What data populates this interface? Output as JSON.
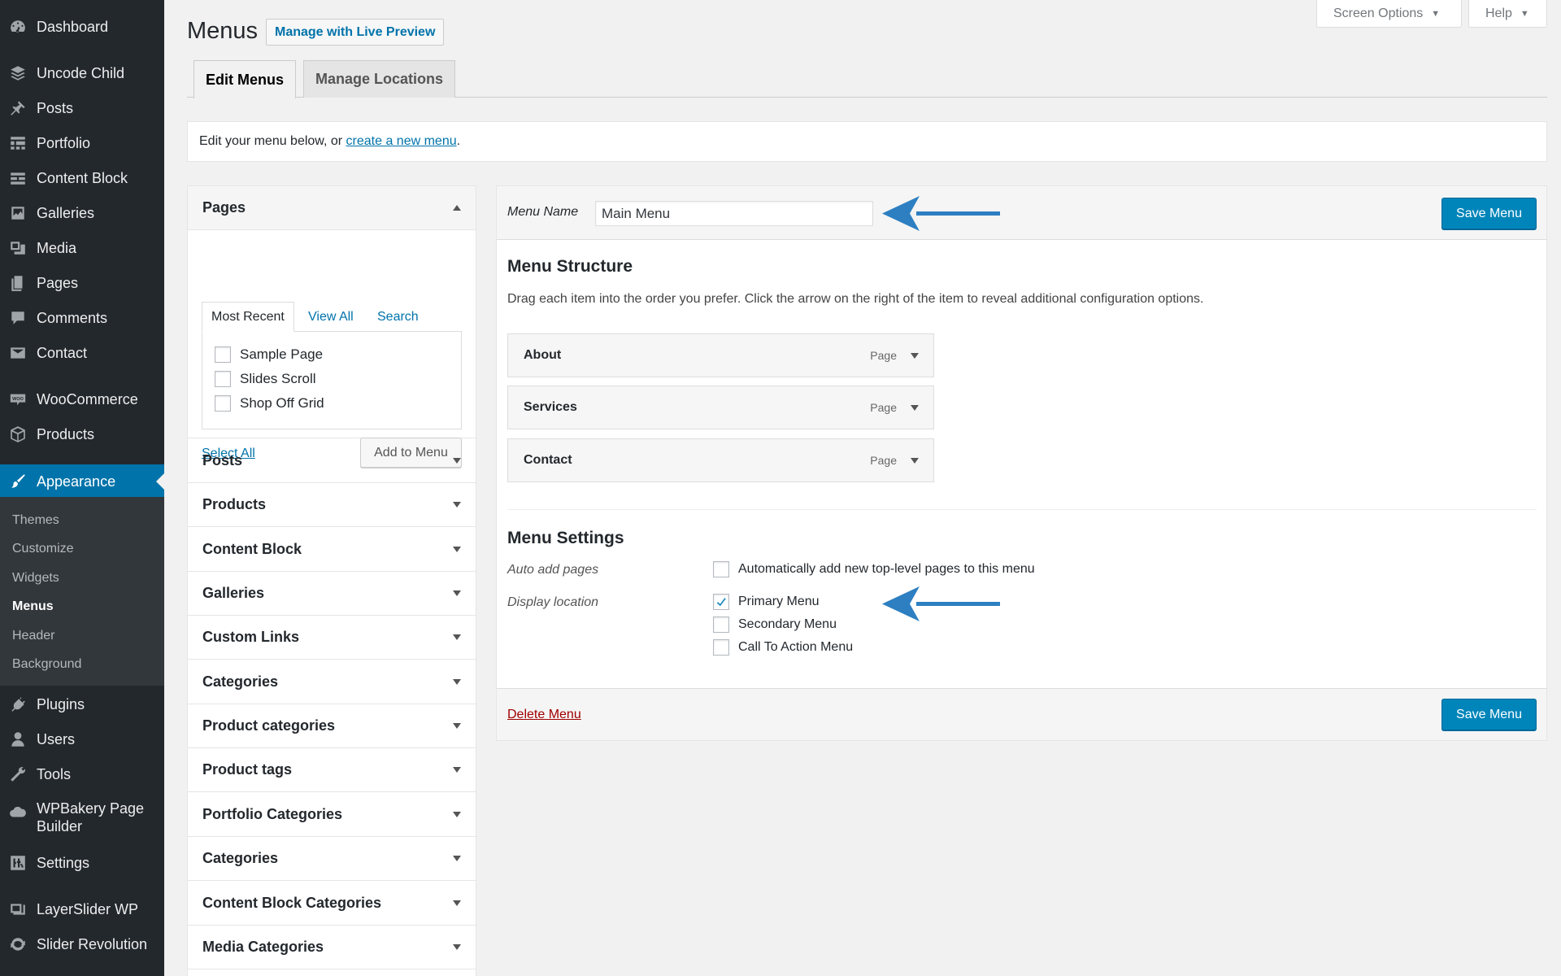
{
  "sidebar": {
    "items": [
      {
        "label": "Dashboard",
        "icon": "dashboard-icon"
      },
      {
        "label": "Uncode Child",
        "icon": "layers-icon"
      },
      {
        "label": "Posts",
        "icon": "pin-icon"
      },
      {
        "label": "Portfolio",
        "icon": "portfolio-icon"
      },
      {
        "label": "Content Block",
        "icon": "content-block-icon"
      },
      {
        "label": "Galleries",
        "icon": "gallery-icon"
      },
      {
        "label": "Media",
        "icon": "media-icon"
      },
      {
        "label": "Pages",
        "icon": "pages-icon"
      },
      {
        "label": "Comments",
        "icon": "comment-icon"
      },
      {
        "label": "Contact",
        "icon": "envelope-icon"
      },
      {
        "label": "WooCommerce",
        "icon": "woocommerce-icon",
        "icon_text": "WOO"
      },
      {
        "label": "Products",
        "icon": "box-icon"
      },
      {
        "label": "Appearance",
        "icon": "paintbrush-icon"
      },
      {
        "label": "Plugins",
        "icon": "plug-icon"
      },
      {
        "label": "Users",
        "icon": "user-icon"
      },
      {
        "label": "Tools",
        "icon": "wrench-icon"
      },
      {
        "label": "WPBakery Page Builder",
        "icon": "cloud-icon"
      },
      {
        "label": "Settings",
        "icon": "sliders-icon"
      },
      {
        "label": "LayerSlider WP",
        "icon": "layerslider-icon"
      },
      {
        "label": "Slider Revolution",
        "icon": "refresh-icon"
      }
    ],
    "submenu": [
      "Themes",
      "Customize",
      "Widgets",
      "Menus",
      "Header",
      "Background"
    ]
  },
  "screen_options": "Screen Options",
  "help": "Help",
  "header": {
    "title": "Menus",
    "live_preview": "Manage with Live Preview"
  },
  "tabs": {
    "edit": "Edit Menus",
    "locations": "Manage Locations"
  },
  "notice": {
    "prefix": "Edit your menu below, or ",
    "link": "create a new menu",
    "suffix": "."
  },
  "accordion": {
    "pages": {
      "title": "Pages",
      "tabs": [
        "Most Recent",
        "View All",
        "Search"
      ],
      "items": [
        "Sample Page",
        "Slides Scroll",
        "Shop Off Grid"
      ],
      "select_all": "Select All",
      "add_button": "Add to Menu"
    },
    "sections": [
      "Posts",
      "Products",
      "Content Block",
      "Galleries",
      "Custom Links",
      "Categories",
      "Product categories",
      "Product tags",
      "Portfolio Categories",
      "Categories",
      "Content Block Categories",
      "Media Categories"
    ]
  },
  "menu": {
    "name_label": "Menu Name",
    "name_value": "Main Menu",
    "save_label": "Save Menu",
    "structure_title": "Menu Structure",
    "structure_desc": "Drag each item into the order you prefer. Click the arrow on the right of the item to reveal additional configuration options.",
    "items": [
      {
        "title": "About",
        "type": "Page"
      },
      {
        "title": "Services",
        "type": "Page"
      },
      {
        "title": "Contact",
        "type": "Page"
      }
    ],
    "settings_title": "Menu Settings",
    "auto_add_label": "Auto add pages",
    "auto_add_text": "Automatically add new top-level pages to this menu",
    "auto_add_checked": false,
    "display_location_label": "Display location",
    "locations": [
      {
        "label": "Primary Menu",
        "checked": true
      },
      {
        "label": "Secondary Menu",
        "checked": false
      },
      {
        "label": "Call To Action Menu",
        "checked": false
      }
    ],
    "delete_label": "Delete Menu"
  },
  "colors": {
    "sidebar_bg": "#23282d",
    "accent": "#0073aa",
    "primary_button": "#0085ba",
    "delete_link": "#a00000",
    "annotation_arrow": "#2d7fc1"
  }
}
